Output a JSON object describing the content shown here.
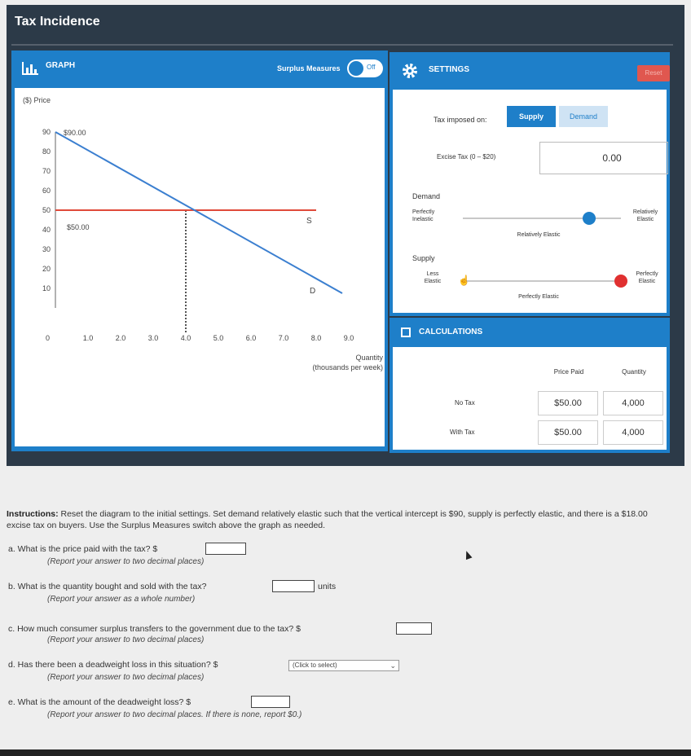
{
  "app": {
    "title": "Tax Incidence"
  },
  "graph": {
    "header_label": "GRAPH",
    "surplus_switch_label": "Surplus Measures",
    "surplus_switch_state": "Off",
    "y_axis_label": "($) Price",
    "y_ticks": [
      "90",
      "80",
      "70",
      "60",
      "50",
      "40",
      "30",
      "20",
      "10"
    ],
    "origin_label": "0",
    "x_ticks": [
      "1.0",
      "2.0",
      "3.0",
      "4.0",
      "5.0",
      "6.0",
      "7.0",
      "8.0",
      "9.0"
    ],
    "x_axis_label_line1": "Quantity",
    "x_axis_label_line2": "(thousands per week)",
    "demand_intercept_label": "$90.00",
    "supply_price_label": "$50.00",
    "supply_curve_label": "S",
    "demand_curve_label": "D",
    "colors": {
      "demand": "#3b7fd0",
      "supply": "#e04a3a",
      "panel": "#1e7fc9"
    }
  },
  "chart_data": {
    "type": "line",
    "xlabel": "Quantity (thousands per week)",
    "ylabel": "($) Price",
    "xlim": [
      0,
      10
    ],
    "ylim": [
      0,
      90
    ],
    "series": [
      {
        "name": "D",
        "x": [
          0,
          8.8
        ],
        "y": [
          90,
          0
        ]
      },
      {
        "name": "S",
        "x": [
          0,
          8.8
        ],
        "y": [
          50,
          50
        ]
      }
    ],
    "equilibrium": {
      "x": 4.0,
      "y": 50
    }
  },
  "settings": {
    "header_label": "SETTINGS",
    "reset_label": "Reset",
    "tax_imposed_label": "Tax imposed on:",
    "tax_options": [
      "Supply",
      "Demand"
    ],
    "tax_selected": "Supply",
    "excise_label": "Excise Tax (0 – $20)",
    "excise_value": "0.00",
    "demand_section": "Demand",
    "demand_left": "Perfectly Inelastic",
    "demand_right": "Relatively Elastic",
    "demand_under": "Relatively Elastic",
    "demand_slider_value": 0.8,
    "supply_section": "Supply",
    "supply_left": "Less Elastic",
    "supply_right": "Perfectly Elastic",
    "supply_under": "Perfectly Elastic",
    "supply_slider_value": 1.0,
    "colors": {
      "demand_knob": "#1e7fc9",
      "supply_knob": "#e03030"
    }
  },
  "calculations": {
    "header_label": "CALCULATIONS",
    "col_price": "Price Paid",
    "col_quantity": "Quantity",
    "rows": [
      {
        "label": "No Tax",
        "price": "$50.00",
        "quantity": "4,000"
      },
      {
        "label": "With Tax",
        "price": "$50.00",
        "quantity": "4,000"
      }
    ]
  },
  "instructions": {
    "lead": "Instructions:",
    "text": " Reset the diagram to the initial settings. Set demand relatively elastic such that the vertical intercept is $90, supply is perfectly elastic, and there is a $18.00 excise tax on buyers. Use the Surplus Measures switch above the graph as needed."
  },
  "questions": {
    "a": {
      "text": "a. What is the price paid with the tax? $",
      "note": "(Report your answer to two decimal places)"
    },
    "b": {
      "text": "b. What is the quantity bought and sold with the tax?",
      "unit": "units",
      "note": "(Report your answer as a whole number)"
    },
    "c": {
      "text": "c. How much consumer surplus transfers to the government due to the tax? $",
      "note": "(Report your answer to two decimal places)"
    },
    "d": {
      "text": "d. Has there been a deadweight loss in this situation? $",
      "select": "(Click to select)",
      "note": "(Report your answer to two decimal places)"
    },
    "e": {
      "text": "e. What is the amount of the deadweight loss? $",
      "note": "(Report your answer to two decimal places. If there is none, report $0.)"
    }
  }
}
